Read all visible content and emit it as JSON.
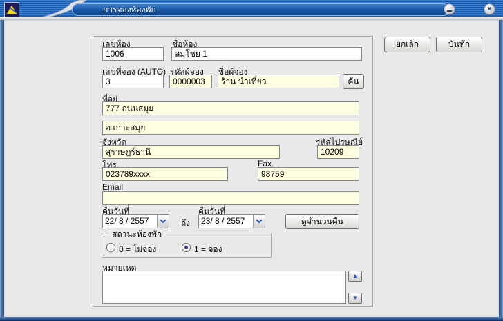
{
  "window": {
    "title": "การจองห้องพัก"
  },
  "actions": {
    "cancel": "ยกเลิก",
    "save": "บันทึก"
  },
  "form": {
    "room_no": {
      "label": "เลขห้อง",
      "value": "1006"
    },
    "room_name": {
      "label": "ชื่อห้อง",
      "value": "ลมโชย 1"
    },
    "booking_no": {
      "label": "เลขที่จอง (AUTO)",
      "value": "3"
    },
    "booker_code": {
      "label": "รหัสผู้จอง",
      "value": "0000003"
    },
    "booker_name": {
      "label": "ชื่อผู้จอง",
      "value": "ร้าน นำเที่ยว"
    },
    "search_button": "ค้น",
    "address1": {
      "label": "ที่อยู่",
      "value": "777 ถนนสมุย"
    },
    "address2": {
      "value": "อ.เกาะสมุย"
    },
    "province": {
      "label": "จังหวัด",
      "value": "สุราษฎร์ธานี"
    },
    "postal": {
      "label": "รหัสไปรษณีย์",
      "value": "10209"
    },
    "phone": {
      "label": "โทร.",
      "value": "023789xxxx"
    },
    "fax": {
      "label": "Fax.",
      "value": "98759"
    },
    "email": {
      "label": "Email",
      "value": ""
    },
    "night_from": {
      "label": "คืนวันที่",
      "value": "22/ 8 / 2557"
    },
    "to_label": "ถึง",
    "night_to": {
      "label": "คืนวันที่",
      "value": "23/ 8 / 2557"
    },
    "nights_button": "ดูจำนวนคืน",
    "status": {
      "legend": "สถานะห้องพัก",
      "options": [
        {
          "label": "0 = ไม่จอง",
          "selected": false
        },
        {
          "label": "1 = จอง",
          "selected": true
        }
      ]
    },
    "notes": {
      "label": "หมายเหตุ",
      "value": ""
    }
  },
  "icons": {
    "close": "×",
    "scroll_up": "▲",
    "scroll_down": "▼"
  },
  "colors": {
    "titlebar_blue": "#1C5DAD",
    "field_yellow": "#FFFFE1",
    "radio_dot": "#44449B",
    "arrow_blue": "#2A58C0",
    "content_gray": "#E9E9E9"
  }
}
